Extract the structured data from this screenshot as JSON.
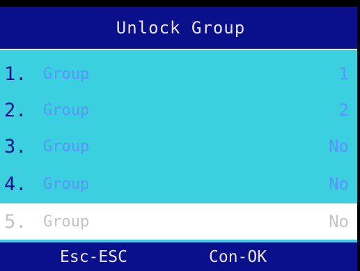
{
  "header": {
    "title": "Unlock Group"
  },
  "list": {
    "items": [
      {
        "number": "1.",
        "label": "Group",
        "value": "1"
      },
      {
        "number": "2.",
        "label": "Group",
        "value": "2"
      },
      {
        "number": "3.",
        "label": "Group",
        "value": "No"
      },
      {
        "number": "4.",
        "label": "Group",
        "value": "No"
      },
      {
        "number": "5.",
        "label": "Group",
        "value": "No"
      }
    ],
    "selected_index": 4
  },
  "footer": {
    "esc_label": "Esc-ESC",
    "ok_label": "Con-OK"
  },
  "colors": {
    "bar_background": "#0a0f8c",
    "list_background": "#3ad0e0",
    "number_text": "#0a0f8c",
    "item_text": "#5c93ff",
    "selected_background": "#ffffff",
    "selected_text": "#c4c4c4"
  }
}
